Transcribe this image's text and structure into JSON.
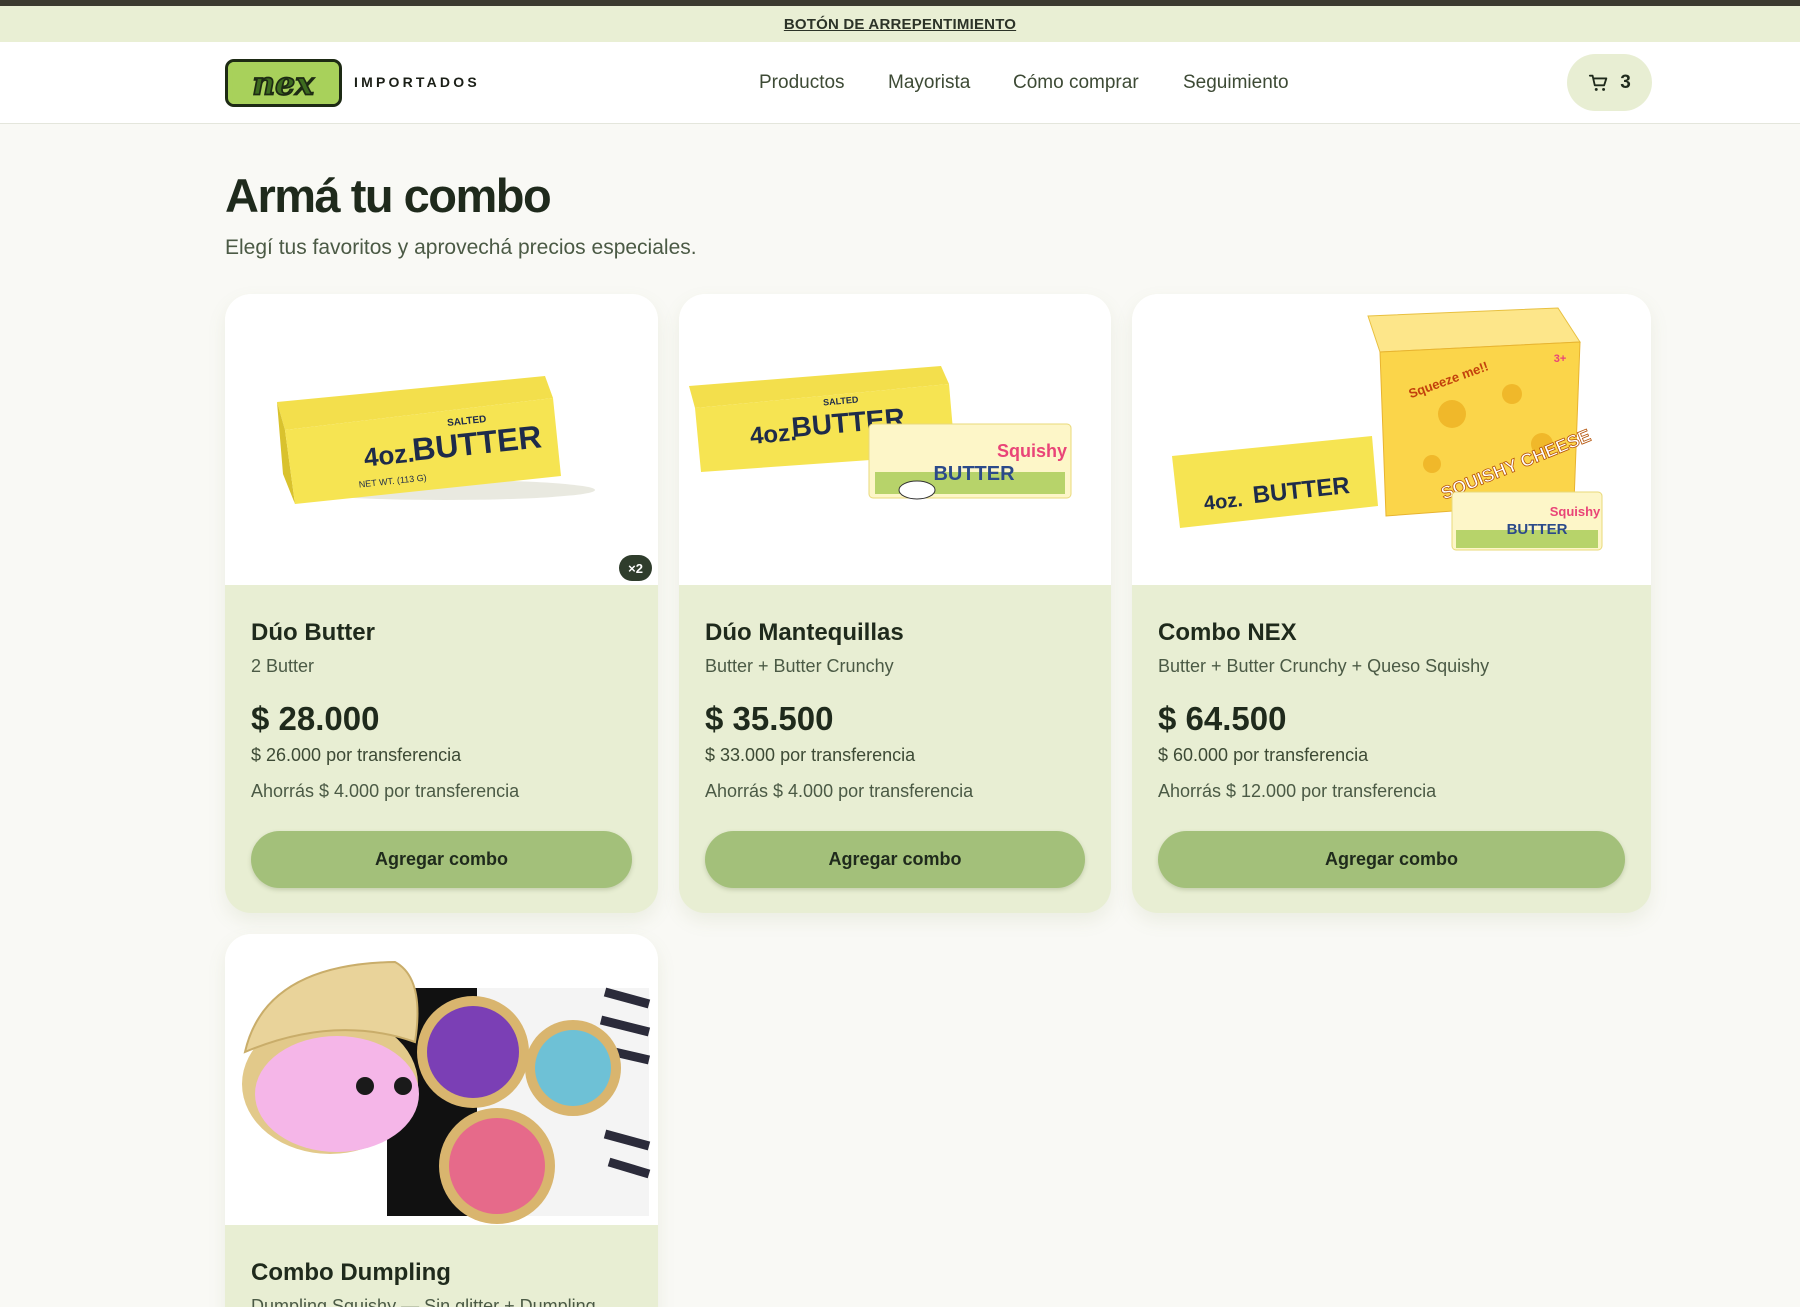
{
  "announcement": {
    "link_label": "BOTÓN DE ARREPENTIMIENTO"
  },
  "header": {
    "logo_text": "nex",
    "brand_word": "IMPORTADOS",
    "nav": [
      "Productos",
      "Mayorista",
      "Cómo comprar",
      "Seguimiento"
    ],
    "cart_count": "3",
    "cart_icon": "cart-icon"
  },
  "page": {
    "title": "Armá tu combo",
    "subtitle": "Elegí tus favoritos y aprovechá precios especiales."
  },
  "combos": [
    {
      "title": "Dúo Butter",
      "items": "2 Butter",
      "price": "$ 28.000",
      "transfer_price": "$ 26.000 por transferencia",
      "savings": "Ahorrás $ 4.000 por transferencia",
      "button_label": "Agregar combo",
      "badge": "×2"
    },
    {
      "title": "Dúo Mantequillas",
      "items": "Butter + Butter Crunchy",
      "price": "$ 35.500",
      "transfer_price": "$ 33.000 por transferencia",
      "savings": "Ahorrás $ 4.000 por transferencia",
      "button_label": "Agregar combo"
    },
    {
      "title": "Combo NEX",
      "items": "Butter + Butter Crunchy + Queso Squishy",
      "price": "$ 64.500",
      "transfer_price": "$ 60.000 por transferencia",
      "savings": "Ahorrás $ 12.000 por transferencia",
      "button_label": "Agregar combo"
    },
    {
      "title": "Combo Dumpling",
      "items": "Dumpling Squishy — Sin glitter + Dumpling"
    }
  ],
  "product_image_text": {
    "salted": "SALTED",
    "weight": "4oz.",
    "butter": "BUTTER",
    "net_wt": "NET WT. (113 G)",
    "squishy": "Squishy",
    "squeeze": "Squeeze me!!",
    "squishy_cheese": "SQUISHY CHEESE",
    "age": "3+"
  },
  "colors": {
    "announce_bg": "#e9efd4",
    "card_bg": "#e8eed3",
    "button_bg": "#a3c07a",
    "text_dark": "#1f2a1c",
    "logo_green": "#a8d15b"
  }
}
